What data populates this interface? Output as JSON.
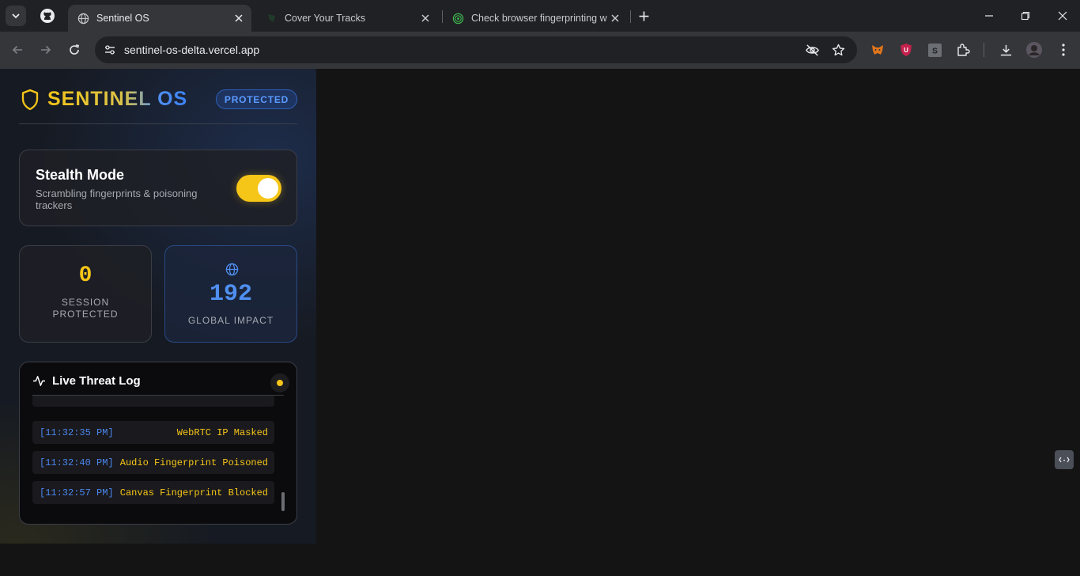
{
  "browser": {
    "tabs": [
      {
        "title": "Sentinel OS",
        "active": true
      },
      {
        "title": "Cover Your Tracks",
        "active": false
      },
      {
        "title": "Check browser fingerprinting w",
        "active": false
      }
    ],
    "url": "sentinel-os-delta.vercel.app"
  },
  "app": {
    "brand": "SENTINEL OS",
    "status_badge": "PROTECTED",
    "stealth": {
      "title": "Stealth Mode",
      "description": "Scrambling fingerprints & poisoning trackers",
      "enabled": true
    },
    "stats": {
      "session_count": "0",
      "session_label": "SESSION PROTECTED",
      "global_count": "192",
      "global_label": "GLOBAL IMPACT"
    },
    "threat_log": {
      "title": "Live Threat Log",
      "entries": [
        {
          "time": "[11:32:35 PM]",
          "event": "WebRTC IP Masked"
        },
        {
          "time": "[11:32:40 PM]",
          "event": "Audio Fingerprint Poisoned"
        },
        {
          "time": "[11:32:57 PM]",
          "event": "Canvas Fingerprint Blocked"
        }
      ]
    }
  },
  "colors": {
    "accent_yellow": "#f5c518",
    "accent_blue": "#3b82f6"
  }
}
